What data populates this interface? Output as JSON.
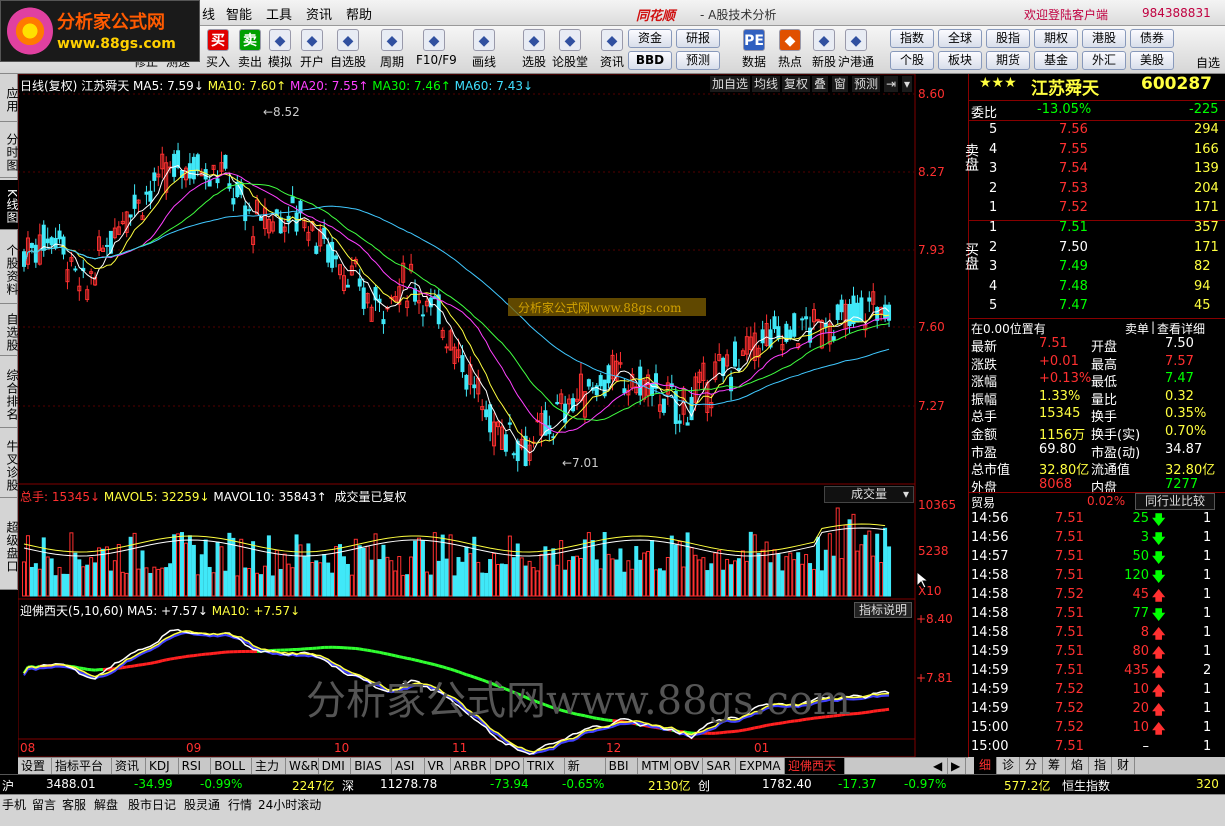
{
  "logo": {
    "title": "分析家公式网",
    "url_text": "www.88gs.com"
  },
  "menu": [
    "线",
    "智能",
    "工具",
    "资讯",
    "帮助"
  ],
  "brand": {
    "name": "同花顺",
    "subtitle": "- A股技术分析"
  },
  "account": {
    "welcome": "欢迎登陆客户端",
    "id": "984388831"
  },
  "toolbar": {
    "buttons": [
      {
        "label": "修正",
        "icon": "edit-icon"
      },
      {
        "label": "测速",
        "icon": "speed-icon"
      },
      {
        "label": "买入",
        "icon": "buy-icon",
        "glyph": "买"
      },
      {
        "label": "卖出",
        "icon": "sell-icon",
        "glyph": "卖"
      },
      {
        "label": "模拟",
        "icon": "hammer-icon"
      },
      {
        "label": "开户",
        "icon": "lock-icon"
      },
      {
        "label": "自选股",
        "icon": "star-icon"
      },
      {
        "label": "周期",
        "icon": "clock-icon"
      },
      {
        "label": "F10/F9",
        "icon": "f10-icon"
      },
      {
        "label": "画线",
        "icon": "pen-icon"
      },
      {
        "label": "选股",
        "icon": "screen-icon"
      },
      {
        "label": "论股堂",
        "icon": "forum-icon"
      },
      {
        "label": "资讯",
        "icon": "news-icon"
      },
      {
        "label": "数据",
        "icon": "pe-icon",
        "glyph": "PE"
      },
      {
        "label": "热点",
        "icon": "hot-icon"
      },
      {
        "label": "新股",
        "icon": "ipo-icon"
      },
      {
        "label": "沪港通",
        "icon": "hk-connect-icon"
      }
    ],
    "pills_row1": [
      "资金",
      "研报",
      "指数",
      "全球",
      "股指",
      "期权",
      "港股",
      "债券"
    ],
    "pills_row2": [
      "BBD",
      "预测",
      "个股",
      "板块",
      "期货",
      "基金",
      "外汇",
      "美股"
    ],
    "extra": "自选"
  },
  "left_tabs": [
    "应用",
    "分时图",
    "K线图",
    "个股资料",
    "自选股",
    "综合排名",
    "牛叉诊股",
    "超级盘口"
  ],
  "kline_header": {
    "title": "日线(复权)",
    "name": "江苏舜天",
    "ma5": "MA5: 7.59↓",
    "ma10": "MA10: 7.60↑",
    "ma20": "MA20: 7.55↑",
    "ma30": "MA30: 7.46↑",
    "ma60": "MA60: 7.43↓",
    "buttons": [
      "加自选",
      "均线",
      "复权",
      "叠",
      "窗",
      "预测"
    ]
  },
  "price_axis": [
    "8.60",
    "8.27",
    "7.93",
    "7.60",
    "7.27"
  ],
  "annotations": {
    "high": "8.52",
    "low": "7.01",
    "watermark_box": "分析家公式网www.88gs.com"
  },
  "volume_header": {
    "total": "总手: 15345↓",
    "mavol5": "MAVOL5: 32259↓",
    "mavol10": "MAVOL10: 35843↑",
    "note": "成交量已复权",
    "select": "成交量"
  },
  "volume_axis": [
    "10365",
    "5238",
    "X10"
  ],
  "indicator_header": {
    "name": "迎佛西天(5,10,60)",
    "ma5": "MA5: +7.57↓",
    "ma10": "MA10: +7.57↓",
    "button": "指标说明"
  },
  "indicator_axis": [
    "+8.40",
    "+7.81"
  ],
  "watermark": "分析家公式网www.88gs.com",
  "months": [
    "08",
    "09",
    "10",
    "11",
    "12",
    "01"
  ],
  "bottom_tabs": [
    "设置",
    "指标平台",
    "资讯",
    "KDJ",
    "RSI",
    "BOLL",
    "主力",
    "W&R",
    "DMI",
    "BIAS",
    "ASI",
    "VR",
    "ARBR",
    "DPO",
    "TRIX",
    "新DMA",
    "BBI",
    "MTM",
    "OBV",
    "SAR",
    "EXPMA",
    "迎佛西天"
  ],
  "right_tabs": [
    "细",
    "诊",
    "分",
    "筹",
    "焰",
    "指",
    "财"
  ],
  "quote": {
    "stars": "★★★",
    "name": "江苏舜天",
    "code": "600287",
    "weibi_label": "委比",
    "weibi": "-13.05%",
    "weicha": "-225",
    "sell_label": "卖盘",
    "buy_label": "买盘",
    "sells": [
      {
        "lvl": "5",
        "price": "7.56",
        "vol": "294"
      },
      {
        "lvl": "4",
        "price": "7.55",
        "vol": "166"
      },
      {
        "lvl": "3",
        "price": "7.54",
        "vol": "139"
      },
      {
        "lvl": "2",
        "price": "7.53",
        "vol": "204"
      },
      {
        "lvl": "1",
        "price": "7.52",
        "vol": "171"
      }
    ],
    "buys": [
      {
        "lvl": "1",
        "price": "7.51",
        "vol": "357"
      },
      {
        "lvl": "2",
        "price": "7.50",
        "vol": "171"
      },
      {
        "lvl": "3",
        "price": "7.49",
        "vol": "82"
      },
      {
        "lvl": "4",
        "price": "7.48",
        "vol": "94"
      },
      {
        "lvl": "5",
        "price": "7.47",
        "vol": "45"
      }
    ],
    "position": "在0.00位置有",
    "sell_order": "卖单",
    "detail": "查看详细",
    "stats": [
      {
        "l1": "最新",
        "v1": "7.51",
        "l2": "开盘",
        "v2": "7.50",
        "c1": "red",
        "c2": "wht"
      },
      {
        "l1": "涨跌",
        "v1": "+0.01",
        "l2": "最高",
        "v2": "7.57",
        "c1": "red",
        "c2": "red"
      },
      {
        "l1": "涨幅",
        "v1": "+0.13%",
        "l2": "最低",
        "v2": "7.47",
        "c1": "red",
        "c2": "grn"
      },
      {
        "l1": "振幅",
        "v1": "1.33%",
        "l2": "量比",
        "v2": "0.32",
        "c1": "yel",
        "c2": "yel"
      },
      {
        "l1": "总手",
        "v1": "15345",
        "l2": "换手",
        "v2": "0.35%",
        "c1": "yel",
        "c2": "yel"
      },
      {
        "l1": "金额",
        "v1": "1156万",
        "l2": "换手(实)",
        "v2": "0.70%",
        "c1": "yel",
        "c2": "yel"
      },
      {
        "l1": "市盈",
        "v1": "69.80",
        "l2": "市盈(动)",
        "v2": "34.87",
        "c1": "wht",
        "c2": "wht"
      },
      {
        "l1": "总市值",
        "v1": "32.80亿",
        "l2": "流通值",
        "v2": "32.80亿",
        "c1": "yel",
        "c2": "yel"
      },
      {
        "l1": "外盘",
        "v1": "8068",
        "l2": "内盘",
        "v2": "7277",
        "c1": "red",
        "c2": "grn"
      }
    ],
    "industry": "贸易",
    "industry_pct": "0.02%",
    "compare": "同行业比较",
    "ticks": [
      {
        "t": "14:56",
        "p": "7.51",
        "v": "25",
        "d": "down",
        "n": "1"
      },
      {
        "t": "14:56",
        "p": "7.51",
        "v": "3",
        "d": "down",
        "n": "1"
      },
      {
        "t": "14:57",
        "p": "7.51",
        "v": "50",
        "d": "down",
        "n": "1"
      },
      {
        "t": "14:58",
        "p": "7.51",
        "v": "120",
        "d": "down",
        "n": "1"
      },
      {
        "t": "14:58",
        "p": "7.52",
        "v": "45",
        "d": "up",
        "n": "1"
      },
      {
        "t": "14:58",
        "p": "7.51",
        "v": "77",
        "d": "down",
        "n": "1"
      },
      {
        "t": "14:58",
        "p": "7.51",
        "v": "8",
        "d": "up",
        "n": "1"
      },
      {
        "t": "14:59",
        "p": "7.51",
        "v": "80",
        "d": "up",
        "n": "1"
      },
      {
        "t": "14:59",
        "p": "7.51",
        "v": "435",
        "d": "up",
        "n": "2"
      },
      {
        "t": "14:59",
        "p": "7.52",
        "v": "10",
        "d": "up",
        "n": "1"
      },
      {
        "t": "14:59",
        "p": "7.52",
        "v": "20",
        "d": "up",
        "n": "1"
      },
      {
        "t": "15:00",
        "p": "7.52",
        "v": "10",
        "d": "up",
        "n": "1"
      },
      {
        "t": "15:00",
        "p": "7.51",
        "v": "–",
        "d": "",
        "n": "1"
      }
    ]
  },
  "status_bar": {
    "sh_label": "沪",
    "sh_idx": "3488.01",
    "sh_chg": "-34.99",
    "sh_pct": "-0.99%",
    "sh_amt": "2247亿",
    "sz_label": "深",
    "sz_idx": "11278.78",
    "sz_chg": "-73.94",
    "sz_pct": "-0.65%",
    "sz_amt": "2130亿",
    "cy_label": "创",
    "cy_idx": "1782.40",
    "cy_chg": "-17.37",
    "cy_pct": "-0.97%",
    "cy_amt": "577.2亿",
    "hs_label": "恒生指数",
    "hs_idx": "320"
  },
  "status_bar2": [
    "手机",
    "留言",
    "客服",
    "解盘",
    "股市日记",
    "股灵通",
    "行情",
    "24小时滚动"
  ]
}
